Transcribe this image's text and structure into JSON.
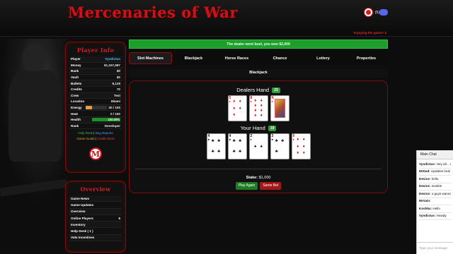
{
  "header": {
    "logo": "Mercenaries of War",
    "notification_count": "(5)",
    "expiry": "Enjoying the game? $",
    "colors": {
      "brand": "#c8141a",
      "discord": "#5865f2"
    }
  },
  "player_info": {
    "title": "Player Info",
    "rows": [
      {
        "label": "Player",
        "value": "Vyndictus"
      },
      {
        "label": "Money",
        "value": "$1,347,687"
      },
      {
        "label": "Bank",
        "value": "$0"
      },
      {
        "label": "Vault",
        "value": "$0"
      },
      {
        "label": "Bullets",
        "value": "8,129"
      },
      {
        "label": "Credits",
        "value": "70"
      },
      {
        "label": "Crew",
        "value": "Test"
      },
      {
        "label": "Location",
        "value": "Miami"
      }
    ],
    "energy": {
      "label": "Energy",
      "value": "30 / 100",
      "fraction": 0.3,
      "color": "#e8a03a"
    },
    "heat": {
      "label": "Heat",
      "value": "0 / 100",
      "fraction": 0,
      "color": "#888"
    },
    "health": {
      "label": "Health",
      "value": "100.00%",
      "fraction": 1,
      "color": "#1f8f2a"
    },
    "rank": {
      "label": "Rank",
      "value": "Developer"
    },
    "links": {
      "help_desk": "Help Desk",
      "bug_reports": "Bug Reports",
      "game_guide": "Game Guide",
      "credit_store": "Credit Store",
      "separator": "|"
    },
    "badge": "M"
  },
  "overview": {
    "title": "Overview",
    "items": [
      {
        "label": "Game News",
        "value": ""
      },
      {
        "label": "Game Updates",
        "value": ""
      },
      {
        "label": "Overview",
        "value": ""
      },
      {
        "label": "Online Players",
        "value": "5"
      },
      {
        "label": "Inventory",
        "value": ""
      },
      {
        "label": "Help Desk ( 1 )",
        "value": ""
      },
      {
        "label": "Vote Incentives",
        "value": ""
      }
    ]
  },
  "main": {
    "alert": "The dealer went bust, you won $2,000",
    "tabs": [
      {
        "label": "Slot Machines",
        "active": true
      },
      {
        "label": "Blackjack",
        "active": false
      },
      {
        "label": "Horse Races",
        "active": false
      },
      {
        "label": "Chance",
        "active": false
      },
      {
        "label": "Lottery",
        "active": false
      },
      {
        "label": "Properties",
        "active": false
      }
    ],
    "section_title": "Blackjack",
    "dealer": {
      "title": "Dealers Hand",
      "total": "23",
      "cards": [
        {
          "rank": "5",
          "suit": "♦",
          "color": "red"
        },
        {
          "rank": "8",
          "suit": "♦",
          "color": "red"
        },
        {
          "rank": "K",
          "suit": "♦",
          "color": "red",
          "face": true
        }
      ]
    },
    "player": {
      "title": "Your Hand",
      "total": "19",
      "cards": [
        {
          "rank": "4",
          "suit": "♣",
          "color": "black"
        },
        {
          "rank": "4",
          "suit": "♣",
          "color": "black"
        },
        {
          "rank": "2",
          "suit": "♠",
          "color": "black"
        },
        {
          "rank": "3",
          "suit": "♣",
          "color": "black"
        },
        {
          "rank": "6",
          "suit": "♦",
          "color": "red"
        }
      ]
    },
    "stake_label": "Stake:",
    "stake_value": "$1,000",
    "play_again": "Play Again",
    "same_bet": "Same Bet"
  },
  "chat": {
    "title": "Main Chat",
    "messages": [
      {
        "user": "Vyndictus:",
        "text": "Hey all... enjoying the game"
      },
      {
        "user": "MrDad:",
        "text": "Updates look"
      },
      {
        "user": "Device:",
        "text": "hello"
      },
      {
        "user": "Device:",
        "text": "newbie"
      },
      {
        "user": "Device:",
        "text": "u guys wanna mail me or pay attention"
      },
      {
        "user": "MrVain:",
        "text": ""
      },
      {
        "user": "Koshka:",
        "text": "Hello"
      },
      {
        "user": "Vyndictus:",
        "text": "Howdy"
      }
    ],
    "placeholder": "Type your message"
  }
}
